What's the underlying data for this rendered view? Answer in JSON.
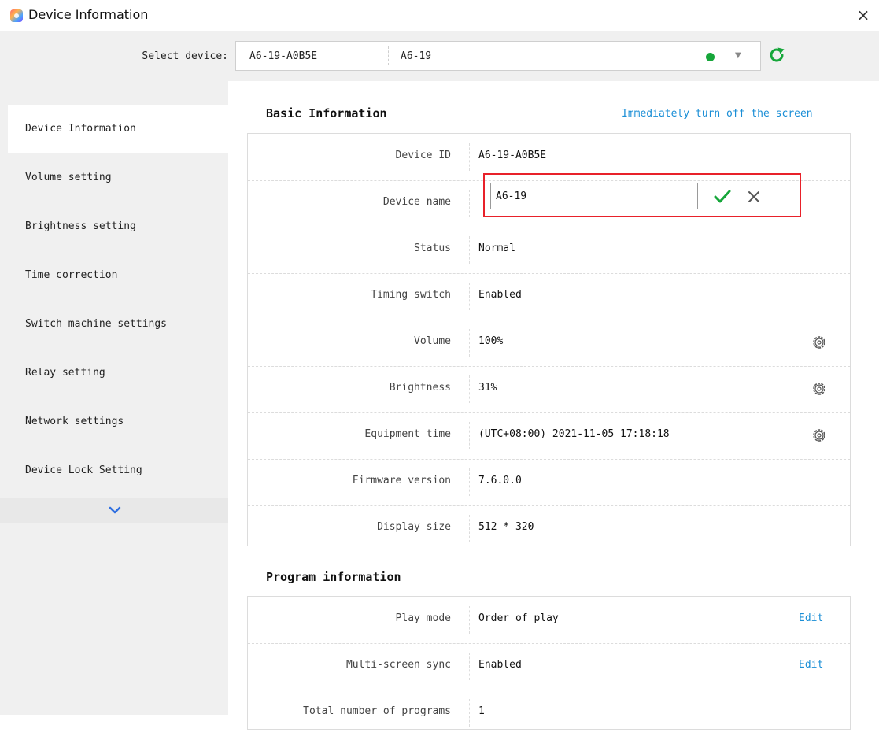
{
  "window": {
    "title": "Device Information",
    "close_glyph": "×"
  },
  "device_bar": {
    "label": "Select device:",
    "device_id": "A6-19-A0B5E",
    "device_name": "A6-19",
    "status_color": "#16a63a",
    "caret": "▼"
  },
  "sidebar": {
    "items": [
      {
        "label": "Device Information"
      },
      {
        "label": "Volume setting"
      },
      {
        "label": "Brightness setting"
      },
      {
        "label": "Time correction"
      },
      {
        "label": "Switch machine settings"
      },
      {
        "label": "Relay setting"
      },
      {
        "label": "Network settings"
      },
      {
        "label": "Device Lock Setting"
      }
    ]
  },
  "basic": {
    "title": "Basic Information",
    "action": "Immediately turn off the screen",
    "rows": [
      {
        "label": "Device ID",
        "value": "A6-19-A0B5E"
      },
      {
        "label": "Device name",
        "value": "A6-19"
      },
      {
        "label": "Status",
        "value": "Normal"
      },
      {
        "label": "Timing switch",
        "value": "Enabled"
      },
      {
        "label": "Volume",
        "value": "100%"
      },
      {
        "label": "Brightness",
        "value": "31%"
      },
      {
        "label": "Equipment time",
        "value": "(UTC+08:00) 2021-11-05 17:18:18"
      },
      {
        "label": "Firmware version",
        "value": "7.6.0.0"
      },
      {
        "label": "Display size",
        "value": "512 * 320"
      }
    ]
  },
  "program": {
    "title": "Program information",
    "rows": [
      {
        "label": "Play mode",
        "value": "Order of play",
        "action": "Edit"
      },
      {
        "label": "Multi-screen sync",
        "value": "Enabled",
        "action": "Edit"
      },
      {
        "label": "Total number of programs",
        "value": "1"
      }
    ]
  },
  "colors": {
    "accent": "#1a8ed6",
    "highlight_border": "#e8212a",
    "confirm": "#16a63a",
    "sidebar_bg": "#f0f0f0"
  }
}
